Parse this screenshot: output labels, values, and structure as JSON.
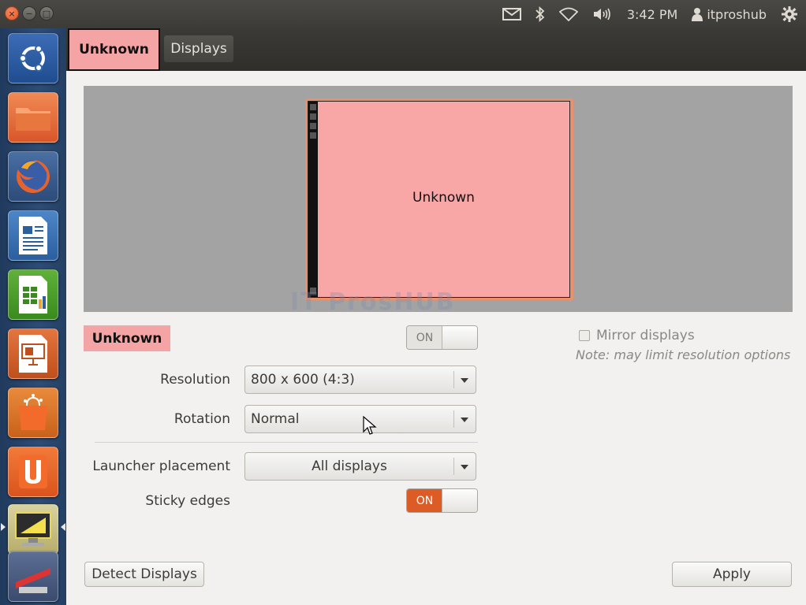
{
  "window": {
    "close_glyph": "×",
    "minimize_glyph": "−",
    "maximize_glyph": "□"
  },
  "top_panel": {
    "indicators": [
      "mail-icon",
      "bluetooth-icon",
      "wifi-icon",
      "volume-icon"
    ],
    "time": "3:42 PM",
    "user": "itproshub",
    "settings_icon": "gear-icon"
  },
  "launcher": {
    "items": [
      "dash-home",
      "files",
      "firefox",
      "libreoffice-writer",
      "libreoffice-calc",
      "libreoffice-impress",
      "ubuntu-software-center",
      "ubuntu-one",
      "displays-settings",
      "system-settings"
    ]
  },
  "tabs": {
    "display_tab": "Unknown",
    "displays_tab": "Displays"
  },
  "preview": {
    "monitor_label": "Unknown",
    "watermark": "IT ProsHUB",
    "monitor_color": "#f8a6a6"
  },
  "display": {
    "name": "Unknown",
    "power_switch": "ON",
    "power_switch_state": "off"
  },
  "mirror": {
    "label": "Mirror displays",
    "checked": false,
    "note": "Note: may limit resolution options"
  },
  "form": {
    "resolution_label": "Resolution",
    "resolution_value": "800 x 600 (4:3)",
    "rotation_label": "Rotation",
    "rotation_value": "Normal",
    "launcher_label": "Launcher placement",
    "launcher_value": "All displays",
    "sticky_label": "Sticky edges",
    "sticky_switch": "ON",
    "sticky_state": "on"
  },
  "buttons": {
    "detect": "Detect Displays",
    "apply": "Apply"
  },
  "colors": {
    "accent": "#dd5b25",
    "highlight": "#f4a4a4"
  }
}
